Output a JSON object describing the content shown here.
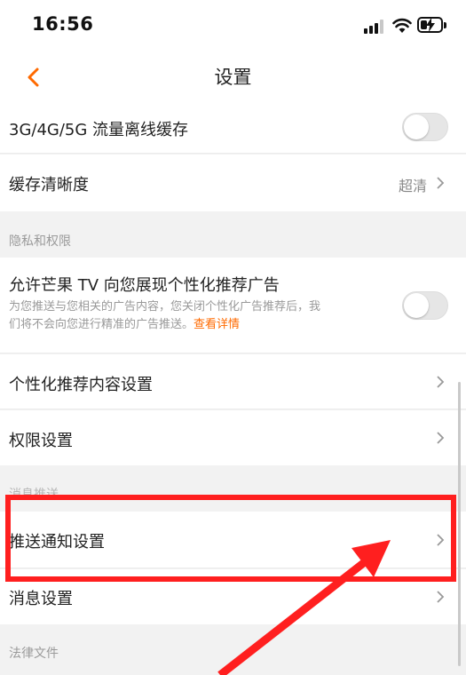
{
  "status_bar": {
    "time": "16:56"
  },
  "nav": {
    "title": "设置"
  },
  "rows": {
    "offline_cache": {
      "label": "3G/4G/5G 流量离线缓存",
      "enabled": false
    },
    "cache_quality": {
      "label": "缓存清晰度",
      "value": "超清"
    },
    "ads": {
      "label": "允许芒果 TV 向您展现个性化推荐广告",
      "desc_line1": "为您推送与您相关的广告内容，您关闭个性化广告推荐后，我",
      "desc_line2": "们将不会向您进行精准的广告推送。",
      "link": "查看详情",
      "enabled": false
    },
    "personalized_content": {
      "label": "个性化推荐内容设置"
    },
    "permissions": {
      "label": "权限设置"
    },
    "push_notifications": {
      "label": "推送通知设置"
    },
    "message_settings": {
      "label": "消息设置"
    }
  },
  "sections": {
    "privacy": "隐私和权限",
    "messages": "消息推送",
    "legal": "法律文件"
  },
  "colors": {
    "accent": "#ff6a00",
    "highlight": "#ff1f1f",
    "background": "#f2f2f2"
  }
}
